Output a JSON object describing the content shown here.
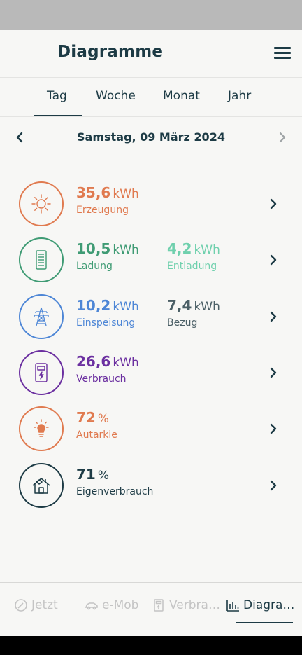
{
  "header": {
    "title": "Diagramme"
  },
  "tabs": [
    {
      "label": "Tag",
      "active": true
    },
    {
      "label": "Woche",
      "active": false
    },
    {
      "label": "Monat",
      "active": false
    },
    {
      "label": "Jahr",
      "active": false
    }
  ],
  "date": {
    "label": "Samstag, 09 März 2024"
  },
  "metrics": {
    "erzeugung": {
      "value": "35,6",
      "unit": "kWh",
      "label": "Erzeugung",
      "color": "#e07a4f",
      "icon": "sun-icon"
    },
    "ladung": {
      "value": "10,5",
      "unit": "kWh",
      "label": "Ladung",
      "color": "#3f9b74",
      "icon": "battery-icon"
    },
    "entladung": {
      "value": "4,2",
      "unit": "kWh",
      "label": "Entladung",
      "color": "#6fd0ad"
    },
    "einspeisung": {
      "value": "10,2",
      "unit": "kWh",
      "label": "Einspeisung",
      "color": "#4d86d6",
      "icon": "power-tower-icon"
    },
    "bezug": {
      "value": "7,4",
      "unit": "kWh",
      "label": "Bezug",
      "color": "#4b5f66"
    },
    "verbrauch": {
      "value": "26,6",
      "unit": "kWh",
      "label": "Verbrauch",
      "color": "#6b2fa0",
      "icon": "meter-icon"
    },
    "autarkie": {
      "value": "72",
      "unit": "%",
      "label": "Autarkie",
      "color": "#e07a4f",
      "icon": "lightbulb-icon"
    },
    "eigenverbrauch": {
      "value": "71",
      "unit": "%",
      "label": "Eigenverbrauch",
      "color": "#1d3b45",
      "icon": "house-icon"
    }
  },
  "bottom_nav": [
    {
      "label": "Jetzt",
      "icon": "gauge-icon",
      "active": false
    },
    {
      "label": "e-Mob",
      "icon": "car-icon",
      "active": false
    },
    {
      "label": "Verbra…",
      "icon": "meter-icon",
      "active": false
    },
    {
      "label": "Diagra…",
      "icon": "bar-chart-icon",
      "active": true
    }
  ]
}
